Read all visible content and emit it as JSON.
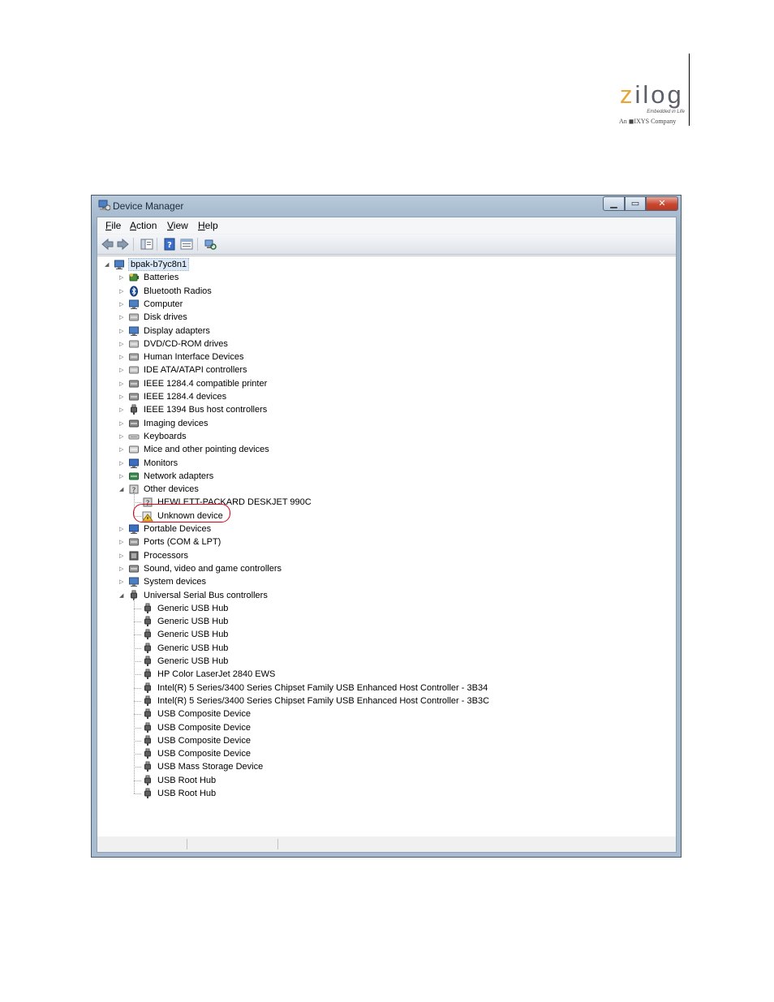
{
  "logo": {
    "word_z": "z",
    "word_rest": "ilog",
    "tagline": "Embedded in Life",
    "company": "An ◼IXYS Company"
  },
  "window": {
    "title": "Device Manager",
    "buttons": {
      "minimize": "▁",
      "maximize": "▭",
      "close": "✕"
    }
  },
  "menu": [
    {
      "key": "F",
      "rest": "ile"
    },
    {
      "key": "A",
      "rest": "ction"
    },
    {
      "key": "V",
      "rest": "iew"
    },
    {
      "key": "H",
      "rest": "elp"
    }
  ],
  "toolbar": {
    "icons": [
      "back-arrow-icon",
      "forward-arrow-icon",
      "show-hide-console-tree-icon",
      "help-icon",
      "properties-icon",
      "scan-hardware-icon"
    ]
  },
  "tree": {
    "root": {
      "label": "bpak-b7yc8n1",
      "expanded": true
    },
    "categories": [
      {
        "label": "Batteries",
        "icon": "battery-icon",
        "expanded": false
      },
      {
        "label": "Bluetooth Radios",
        "icon": "bluetooth-icon",
        "expanded": false
      },
      {
        "label": "Computer",
        "icon": "computer-icon",
        "expanded": false
      },
      {
        "label": "Disk drives",
        "icon": "disk-drive-icon",
        "expanded": false
      },
      {
        "label": "Display adapters",
        "icon": "display-adapter-icon",
        "expanded": false
      },
      {
        "label": "DVD/CD-ROM drives",
        "icon": "dvd-drive-icon",
        "expanded": false
      },
      {
        "label": "Human Interface Devices",
        "icon": "hid-icon",
        "expanded": false
      },
      {
        "label": "IDE ATA/ATAPI controllers",
        "icon": "ide-controller-icon",
        "expanded": false
      },
      {
        "label": "IEEE 1284.4 compatible printer",
        "icon": "printer-icon",
        "expanded": false
      },
      {
        "label": "IEEE 1284.4 devices",
        "icon": "printer-icon",
        "expanded": false
      },
      {
        "label": "IEEE 1394 Bus host controllers",
        "icon": "usb-plug-icon",
        "expanded": false
      },
      {
        "label": "Imaging devices",
        "icon": "camera-icon",
        "expanded": false
      },
      {
        "label": "Keyboards",
        "icon": "keyboard-icon",
        "expanded": false
      },
      {
        "label": "Mice and other pointing devices",
        "icon": "mouse-icon",
        "expanded": false
      },
      {
        "label": "Monitors",
        "icon": "monitor-icon",
        "expanded": false
      },
      {
        "label": "Network adapters",
        "icon": "network-adapter-icon",
        "expanded": false
      },
      {
        "label": "Other devices",
        "icon": "unknown-device-icon",
        "expanded": true,
        "children": [
          {
            "label": "HEWLETT-PACKARD DESKJET 990C",
            "icon": "unknown-device-icon"
          },
          {
            "label": "Unknown device",
            "icon": "warning-device-icon"
          }
        ]
      },
      {
        "label": "Portable Devices",
        "icon": "portable-device-icon",
        "expanded": false
      },
      {
        "label": "Ports (COM & LPT)",
        "icon": "port-icon",
        "expanded": false
      },
      {
        "label": "Processors",
        "icon": "processor-icon",
        "expanded": false
      },
      {
        "label": "Sound, video and game controllers",
        "icon": "speaker-icon",
        "expanded": false
      },
      {
        "label": "System devices",
        "icon": "system-device-icon",
        "expanded": false
      },
      {
        "label": "Universal Serial Bus controllers",
        "icon": "usb-plug-icon",
        "expanded": true,
        "children": [
          {
            "label": "Generic USB Hub",
            "icon": "usb-plug-icon"
          },
          {
            "label": "Generic USB Hub",
            "icon": "usb-plug-icon"
          },
          {
            "label": "Generic USB Hub",
            "icon": "usb-plug-icon"
          },
          {
            "label": "Generic USB Hub",
            "icon": "usb-plug-icon"
          },
          {
            "label": "Generic USB Hub",
            "icon": "usb-plug-icon"
          },
          {
            "label": "HP Color LaserJet 2840 EWS",
            "icon": "usb-plug-icon"
          },
          {
            "label": "Intel(R) 5 Series/3400 Series Chipset Family USB Enhanced Host Controller - 3B34",
            "icon": "usb-plug-icon"
          },
          {
            "label": "Intel(R) 5 Series/3400 Series Chipset Family USB Enhanced Host Controller - 3B3C",
            "icon": "usb-plug-icon"
          },
          {
            "label": "USB Composite Device",
            "icon": "usb-plug-icon"
          },
          {
            "label": "USB Composite Device",
            "icon": "usb-plug-icon"
          },
          {
            "label": "USB Composite Device",
            "icon": "usb-plug-icon"
          },
          {
            "label": "USB Composite Device",
            "icon": "usb-plug-icon"
          },
          {
            "label": "USB Mass Storage Device",
            "icon": "usb-plug-icon"
          },
          {
            "label": "USB Root Hub",
            "icon": "usb-plug-icon"
          },
          {
            "label": "USB Root Hub",
            "icon": "usb-plug-icon"
          }
        ]
      }
    ]
  },
  "annotation": {
    "highlighted_item": "Unknown device",
    "color": "#d0021b"
  }
}
